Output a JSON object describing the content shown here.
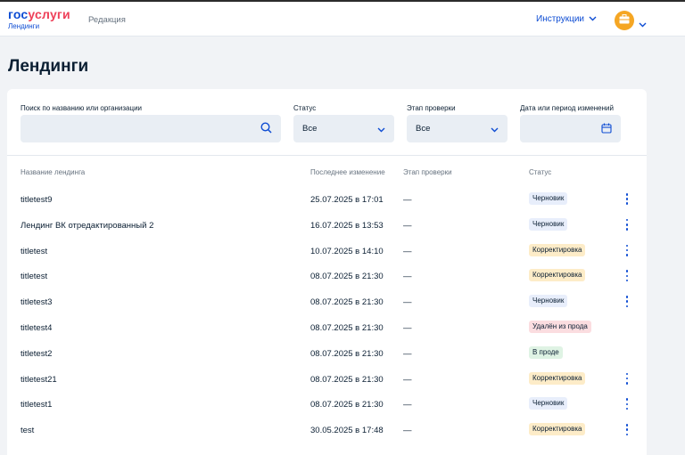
{
  "header": {
    "logo_part1": "гос",
    "logo_part2": "услуги",
    "logo_sub": "Лендинги",
    "section": "Редакция",
    "instructions_label": "Инструкции"
  },
  "page": {
    "title": "Лендинги"
  },
  "filters": {
    "search_label": "Поиск по названию или организации",
    "search_value": "",
    "status_label": "Статус",
    "status_value": "Все",
    "stage_label": "Этап проверки",
    "stage_value": "Все",
    "date_label": "Дата или период изменений",
    "date_value": ""
  },
  "table": {
    "columns": [
      "Название лендинга",
      "Последнее изменение",
      "Этап проверки",
      "Статус"
    ],
    "rows": [
      {
        "name": "titletest9",
        "changed": "25.07.2025 в 17:01",
        "stage": "—",
        "status": "Черновик",
        "menu": true
      },
      {
        "name": "Лендинг ВК отредактированный 2",
        "changed": "16.07.2025 в 13:53",
        "stage": "—",
        "status": "Черновик",
        "menu": true
      },
      {
        "name": "titletest",
        "changed": "10.07.2025 в 14:10",
        "stage": "—",
        "status": "Корректировка",
        "menu": true
      },
      {
        "name": "titletest",
        "changed": "08.07.2025 в 21:30",
        "stage": "—",
        "status": "Корректировка",
        "menu": true
      },
      {
        "name": "titletest3",
        "changed": "08.07.2025 в 21:30",
        "stage": "—",
        "status": "Черновик",
        "menu": true
      },
      {
        "name": "titletest4",
        "changed": "08.07.2025 в 21:30",
        "stage": "—",
        "status": "Удалён из прода",
        "menu": false
      },
      {
        "name": "titletest2",
        "changed": "08.07.2025 в 21:30",
        "stage": "—",
        "status": "В проде",
        "menu": false
      },
      {
        "name": "titletest21",
        "changed": "08.07.2025 в 21:30",
        "stage": "—",
        "status": "Корректировка",
        "menu": true
      },
      {
        "name": "titletest1",
        "changed": "08.07.2025 в 21:30",
        "stage": "—",
        "status": "Черновик",
        "menu": true
      },
      {
        "name": "test",
        "changed": "30.05.2025 в 17:48",
        "stage": "—",
        "status": "Корректировка",
        "menu": true
      }
    ]
  },
  "status_colors": {
    "Черновик": {
      "bg": "#e8eefb",
      "fg": "#0b1f33"
    },
    "Корректировка": {
      "bg": "#fdecc8",
      "fg": "#0b1f33"
    },
    "Удалён из прода": {
      "bg": "#fbdde0",
      "fg": "#0b1f33"
    },
    "В проде": {
      "bg": "#dff3e4",
      "fg": "#0b1f33"
    }
  },
  "colors": {
    "accent": "#0d4cd3",
    "avatar": "#f5a623"
  }
}
